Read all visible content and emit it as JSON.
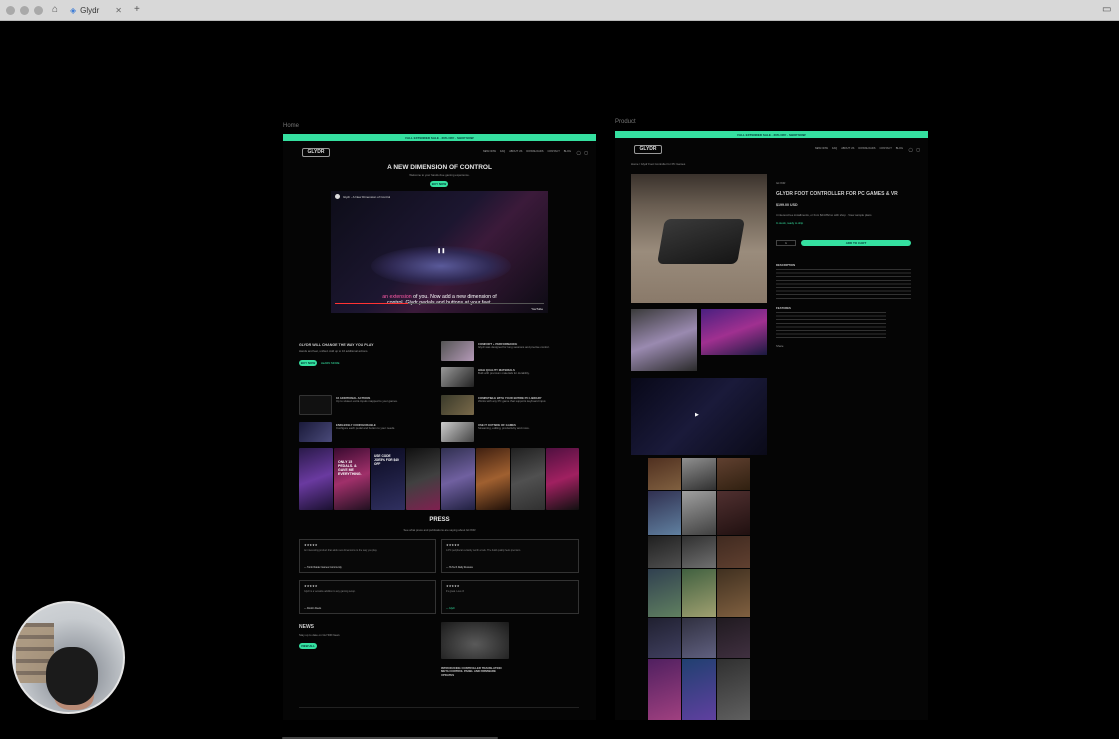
{
  "browser": {
    "tab_title": "Glydr",
    "new_tab": "+",
    "close": "✕"
  },
  "frames": {
    "home_label": "Home",
    "product_label": "Product"
  },
  "home": {
    "banner": "FALL EXTENDED SALE · 20% OFF · SHOP NOW",
    "logo": "GLYDR",
    "nav": [
      "NEW NOW",
      "FAQ",
      "ABOUT US",
      "DOWNLOADS",
      "CONTACT",
      "BLOG"
    ],
    "hero_title": "A NEW DIMENSION OF CONTROL",
    "hero_sub": "Welcome to your hands-free gaming experience.",
    "hero_button": "BUY NOW",
    "video_channel": "Glydr - A New Dimension of Control",
    "video_caption_1": "an extension of you. Now add a new dimension of",
    "video_caption_highlight": "an extension",
    "video_caption_rest_1": " of you. Now add a new dimension of",
    "video_caption_2": "control. Glydr pedals and buttons at your feet.",
    "youtube": "YouTube",
    "change_title": "GLYDR WILL CHANGE THE WAY YOU PLAY",
    "change_text": "Hands and feet, unified. Add up to 16 additional actions.",
    "change_btn": "BUY NOW",
    "change_link": "LEARN MORE",
    "features": [
      {
        "title": "COMFORT + PERFORMANCE",
        "text": "Glydr was designed for long sessions and precise control."
      },
      {
        "title": "HIGH QUALITY MATERIALS",
        "text": "Built with premium materials for durability."
      },
      {
        "title": "16 ADDITIONAL ACTIONS",
        "text": "Up to sixteen extra inputs mapped to your games."
      },
      {
        "title": "COMPATIBLE WITH YOUR ENTIRE PC LIBRARY",
        "text": "Works with any PC game that supports keyboard input."
      },
      {
        "title": "ENDLESSLY CONFIGURABLE",
        "text": "Configure each pedal and button to your needs."
      },
      {
        "title": "USE IT OUTSIDE OF GAMES",
        "text": "Streaming, editing, productivity and more."
      }
    ],
    "ugc_text_1": "ONLY 15 PEDALS. & GAVE ME EVERYTHING.",
    "ugc_text_2": "USE CODE JOE5% FOR $40 OFF",
    "press_title": "PRESS",
    "press_sub": "See what press and publications are saying about GLYDR",
    "press": [
      {
        "stars": "★★★★★",
        "text": "An interesting product that adds new dimensions to the way you play.",
        "author": "— Tomb Raider Games Community"
      },
      {
        "stars": "★★★★★",
        "text": "A PC peripheral certainly worth a look. The build quality feels premium.",
        "author": "— Hi-Tech Daily Reviews"
      },
      {
        "stars": "★★★★★",
        "text": "Glydr is a versatile addition to any gaming setup.",
        "author": "— Rockin Reels"
      },
      {
        "stars": "★★★★★",
        "text": "It's great. Love it!",
        "author": "— Glydr"
      }
    ],
    "news_title": "NEWS",
    "news_sub": "Stay up to date on GLYDR News",
    "news_btn": "VIEW ALL",
    "news_article_title": "INTRODUCING CONTROLLER TRANSLATION META CONTROL PANEL AND FIRMWARE UPDATES"
  },
  "product": {
    "banner": "FALL EXTENDED SALE · 20% OFF · SHOP NOW",
    "logo": "GLYDR",
    "breadcrumb": "Home / Glydr Foot Controller for PC Games",
    "vendor": "GLYDR",
    "title": "GLYDR FOOT CONTROLLER FOR PC GAMES & VR",
    "price": "$199.00 USD",
    "installments": "4 interest-free installments, or from $24.86/mo with shop · View sample plans",
    "in_stock": "In stock, ready to ship",
    "qty": "1",
    "add_to_cart": "ADD TO CART",
    "description_title": "DESCRIPTION",
    "features_title": "FEATURES",
    "share": "Share"
  }
}
